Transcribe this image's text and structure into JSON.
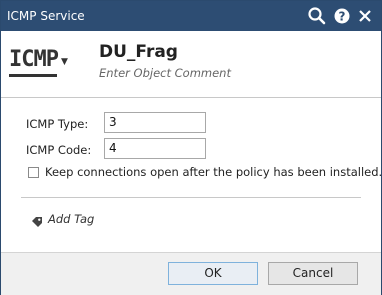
{
  "window": {
    "title": "ICMP Service"
  },
  "titlebar_icons": [
    "search-icon",
    "help-icon",
    "close-icon"
  ],
  "header": {
    "type_icon_text": "ICMP",
    "object_name": "DU_Frag",
    "comment_placeholder": "Enter Object Comment"
  },
  "form": {
    "icmp_type_label": "ICMP Type:",
    "icmp_type_value": "3",
    "icmp_code_label": "ICMP Code:",
    "icmp_code_value": "4",
    "keep_connections_label": "Keep connections open after the policy has been installed.",
    "keep_connections_checked": false
  },
  "tags": {
    "add_tag_label": "Add Tag"
  },
  "buttons": {
    "ok": "OK",
    "cancel": "Cancel"
  },
  "colors": {
    "titlebar": "#2d4d73",
    "footer": "#f0f0f0",
    "ok_button_border": "#7fb2dc"
  }
}
